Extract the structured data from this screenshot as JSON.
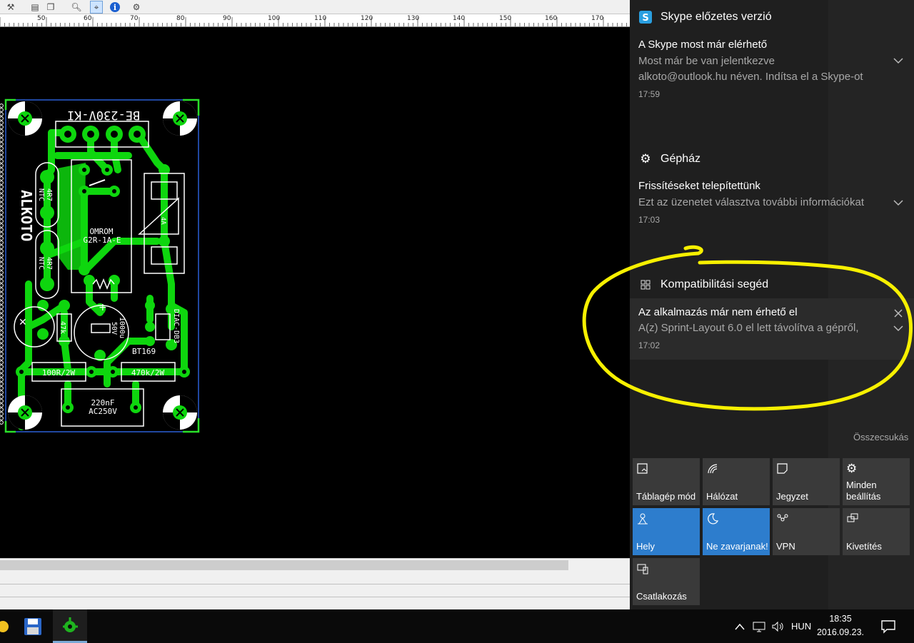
{
  "toolbar": {
    "icons": [
      "tools-icon",
      "layers-icon",
      "zoom-icon",
      "select-icon",
      "info-icon",
      "settings-icon"
    ]
  },
  "ruler": {
    "labels": [
      "50",
      "60",
      "70",
      "80",
      "90",
      "100",
      "110",
      "120",
      "130",
      "140",
      "150",
      "160",
      "170"
    ]
  },
  "pcb": {
    "title_text": "BE-230V-KI",
    "logo_text": "ALKOTO",
    "ntc1_a": "NTC",
    "ntc1_b": "4R7",
    "ntc2_a": "NTC",
    "ntc2_b": "4R7",
    "relay_a": "OMROM",
    "relay_b": "G2R-1A-E",
    "res_47k": "47k",
    "cap_a": "1000u",
    "cap_b": "50V",
    "triac": "BT169",
    "diac": "DIAC-DB3",
    "res_100r": "100R/2W",
    "res_470k": "470k/2W",
    "cap2_a": "220nF",
    "cap2_b": "AC250V",
    "fuse": "4A",
    "colors": {
      "track": "#0ed60e",
      "outline": "#ffffff",
      "board_edge": "#2a5fd6",
      "corner": "#2ae02a"
    }
  },
  "action_center": {
    "groups": [
      {
        "title": "Skype előzetes verzió",
        "icon": "skype-icon",
        "notification": {
          "title": "A Skype most már elérhető",
          "body_lines": [
            "Most már be van jelentkezve",
            "alkoto@outlook.hu néven. Indítsa el a Skype-ot"
          ],
          "time": "17:59"
        }
      },
      {
        "title": "Gépház",
        "icon": "gear-icon",
        "notification": {
          "title": "Frissítéseket telepítettünk",
          "body_lines": [
            "Ezt az üzenetet választva további információkat"
          ],
          "time": "17:03"
        }
      },
      {
        "title": "Kompatibilitási segéd",
        "icon": "compat-icon",
        "notification": {
          "title": "Az alkalmazás már nem érhető el",
          "body_lines": [
            "A(z) Sprint-Layout 6.0 el lett távolítva a gépről,"
          ],
          "time": "17:02"
        }
      }
    ],
    "collapse_label": "Összecsukás",
    "quick_actions": [
      {
        "label": "Táblagép mód",
        "icon": "tablet-mode-icon",
        "on": false
      },
      {
        "label": "Hálózat",
        "icon": "network-icon",
        "on": false
      },
      {
        "label": "Jegyzet",
        "icon": "note-icon",
        "on": false
      },
      {
        "label": "Minden\nbeállítás",
        "icon": "settings-icon",
        "on": false
      },
      {
        "label": "Hely",
        "icon": "location-icon",
        "on": true
      },
      {
        "label": "Ne zavarjanak!",
        "icon": "moon-icon",
        "on": true
      },
      {
        "label": "VPN",
        "icon": "vpn-icon",
        "on": false
      },
      {
        "label": "Kivetítés",
        "icon": "project-icon",
        "on": false
      },
      {
        "label": "Csatlakozás",
        "icon": "connect-icon",
        "on": false
      }
    ],
    "colors": {
      "accent": "#2d7dcd",
      "panel": "#1f1f1f",
      "tile": "#3a3a3a",
      "highlight_ring": "#f7f000"
    }
  },
  "taskbar": {
    "language": "HUN",
    "time": "18:35",
    "date": "2016.09.23."
  }
}
